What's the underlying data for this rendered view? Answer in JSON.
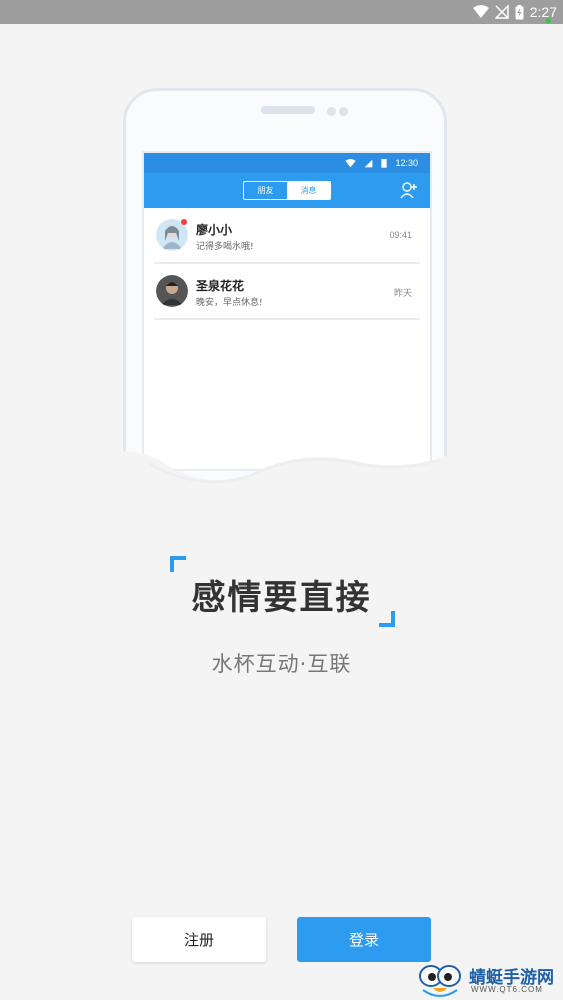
{
  "status_bar": {
    "time": "2:27"
  },
  "phone": {
    "status_time": "12:30",
    "tabs": [
      {
        "label": "朋友",
        "active": false
      },
      {
        "label": "消息",
        "active": true
      }
    ],
    "chats": [
      {
        "name": "廖小小",
        "message": "记得多喝水哦!",
        "time": "09:41",
        "unread": true
      },
      {
        "name": "圣泉花花",
        "message": "晚安，早点休息!",
        "time": "昨天",
        "unread": false
      }
    ]
  },
  "slogan": {
    "title": "感情要直接",
    "subtitle": "水杯互动·互联"
  },
  "buttons": {
    "register": "注册",
    "login": "登录"
  },
  "watermark": {
    "text": "蜻蜓手游网",
    "url": "WWW.QT6.COM"
  },
  "colors": {
    "accent": "#2d9cf0",
    "background": "#f4f4f4"
  }
}
